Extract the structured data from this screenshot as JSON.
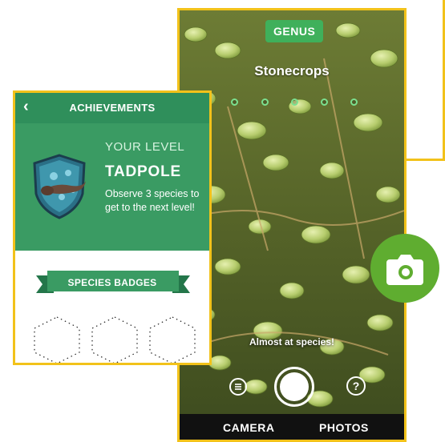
{
  "camera": {
    "genus_badge": "GENUS",
    "genus_name": "Stonecrops",
    "status_text": "Almost at species!",
    "help_label": "?",
    "tabs": [
      {
        "label": "CAMERA"
      },
      {
        "label": "PHOTOS"
      }
    ]
  },
  "achievements": {
    "back_label": "‹",
    "title": "ACHIEVEMENTS",
    "your_level_label": "YOUR LEVEL",
    "level_name": "TADPOLE",
    "level_description": "Observe 3 species to get to the next level!",
    "species_badges_label": "SPECIES BADGES"
  },
  "colors": {
    "accent_yellow": "#f2c21a",
    "brand_green": "#3a9b63",
    "genus_green": "#3fb05b",
    "fab_green": "#5fad30"
  },
  "icons": [
    "shield-tadpole-icon",
    "camera-icon",
    "menu-icon",
    "help-icon",
    "back-chevron-icon",
    "hexagon-badge-placeholder-icon"
  ]
}
